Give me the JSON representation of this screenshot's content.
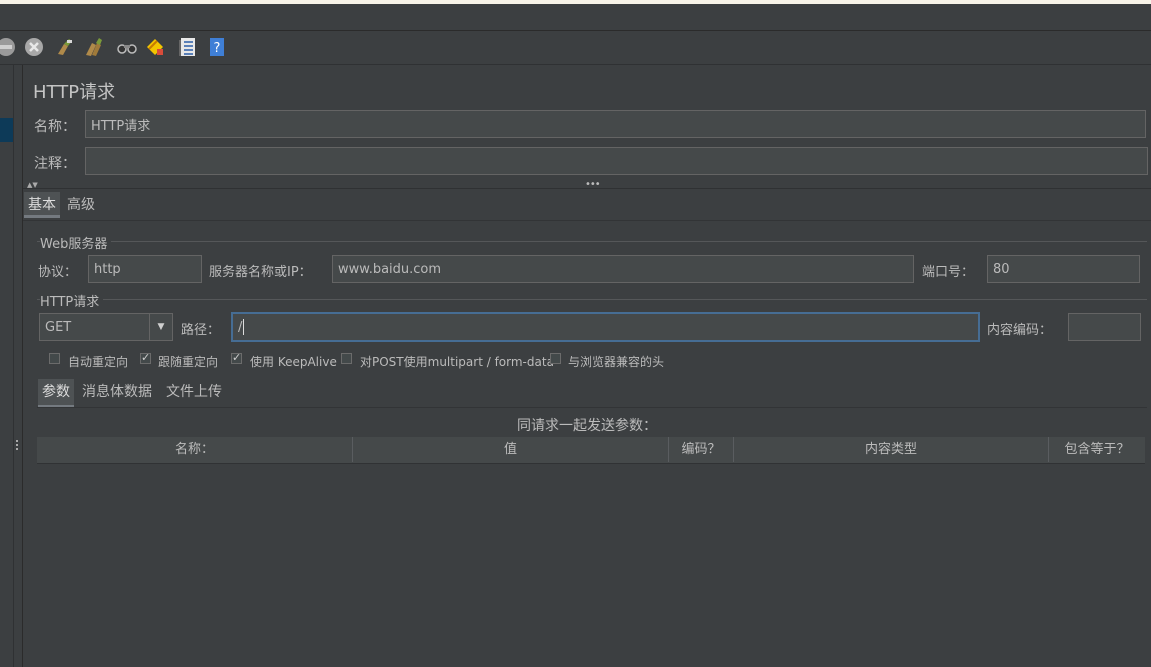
{
  "panel_title": "HTTP请求",
  "name_label": "名称：",
  "name_value": "HTTP请求",
  "comment_label": "注释：",
  "comment_value": "",
  "tabs": {
    "basic": "基本",
    "advanced": "高级"
  },
  "web_server": {
    "group_title": "Web服务器",
    "protocol_label": "协议：",
    "protocol_value": "http",
    "server_label": "服务器名称或IP：",
    "server_value": "www.baidu.com",
    "port_label": "端口号：",
    "port_value": "80"
  },
  "http_request": {
    "group_title": "HTTP请求",
    "method": "GET",
    "path_label": "路径：",
    "path_value": "/",
    "encoding_label": "内容编码：",
    "encoding_value": ""
  },
  "options": [
    {
      "label": "自动重定向",
      "checked": false
    },
    {
      "label": "跟随重定向",
      "checked": true
    },
    {
      "label": "使用 KeepAlive",
      "checked": true
    },
    {
      "label": "对POST使用multipart / form-data",
      "checked": false
    },
    {
      "label": "与浏览器兼容的头",
      "checked": false
    }
  ],
  "sub_tabs": {
    "params": "参数",
    "body": "消息体数据",
    "files": "文件上传"
  },
  "params_caption": "同请求一起发送参数：",
  "table_headers": [
    "名称：",
    "值",
    "编码？",
    "内容类型",
    "包含等于？"
  ]
}
